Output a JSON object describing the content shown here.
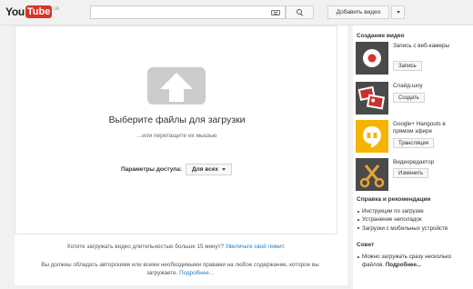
{
  "header": {
    "logo_you": "You",
    "logo_tube": "Tube",
    "logo_region": "UA",
    "search_placeholder": "",
    "add_video_label": "Добавить видео"
  },
  "upload": {
    "title": "Выберите файлы для загрузки",
    "subtitle": "...или перетащите их мышью",
    "access_label": "Параметры доступа:",
    "access_value": "Для всех",
    "long_video_text": "Хотите загружать видео длительностью больше 15 минут?",
    "long_video_link": "Увеличьте свой лимит.",
    "rights_text": "Вы должны обладать авторскими или всеми необходимыми правами на любое содержание, которое вы загружаете.",
    "rights_link": "Подробнее..."
  },
  "sidebar": {
    "create_title": "Создание видео",
    "tools": [
      {
        "label": "Запись с веб-камеры",
        "button": "Запись",
        "icon": "webcam-record-icon"
      },
      {
        "label": "Слайд-шоу",
        "button": "Создать",
        "icon": "slideshow-icon"
      },
      {
        "label": "Google+ Hangouts в прямом эфире",
        "button": "Трансляция",
        "icon": "hangouts-icon"
      },
      {
        "label": "Видеоредактор",
        "button": "Изменить",
        "icon": "scissors-icon"
      }
    ],
    "help_title": "Справка и рекомендации",
    "help_items": [
      "Инструкции по загрузке",
      "Устранение неполадок",
      "Загрузки с мобильных устройств"
    ],
    "tip_title": "Совет",
    "tip_text": "Можно загружать сразу несколько файлов.",
    "tip_link": "Подробнее..."
  },
  "colors": {
    "brand_red": "#d8332a",
    "link_blue": "#1b7fcc",
    "upload_icon_gray": "#cccccc",
    "hangouts_yellow": "#f4b400",
    "editor_orange": "#e8a33a"
  }
}
